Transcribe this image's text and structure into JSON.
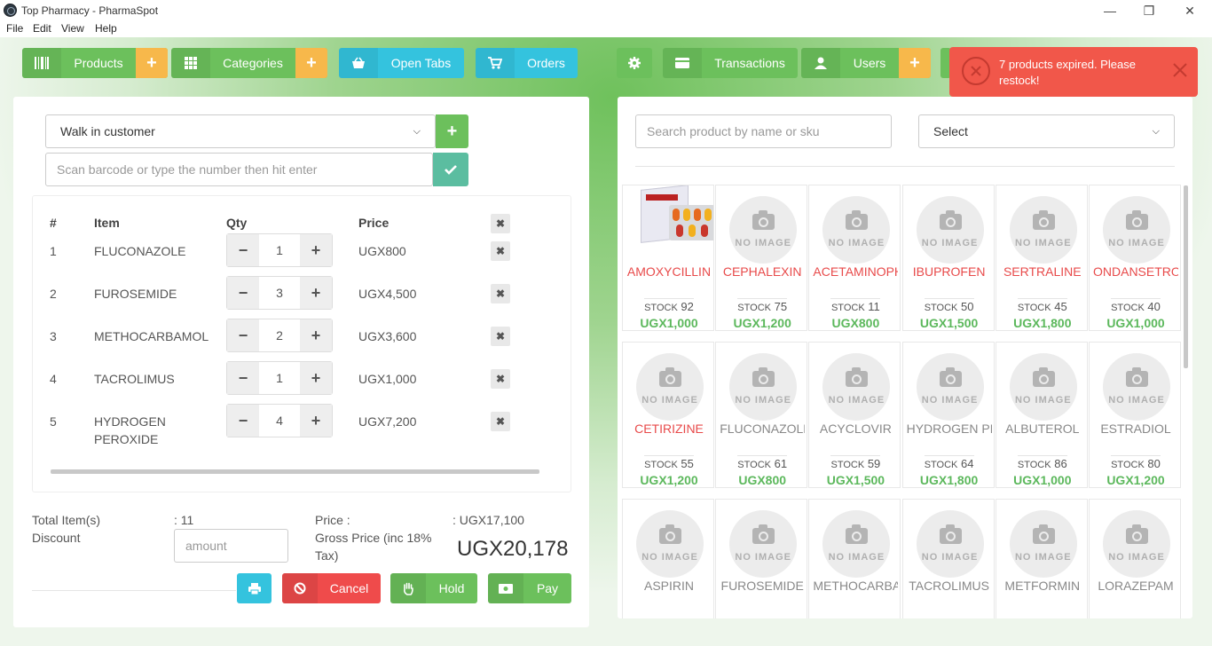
{
  "window": {
    "title": "Top Pharmacy - PharmaSpot",
    "minimize": "—",
    "restore": "❐",
    "close": "✕"
  },
  "menu": [
    "File",
    "Edit",
    "View",
    "Help"
  ],
  "toolbar": {
    "products": "Products",
    "categories": "Categories",
    "open_tabs": "Open Tabs",
    "orders": "Orders",
    "transactions": "Transactions",
    "users": "Users",
    "plus": "+"
  },
  "toast": {
    "message": "7 products expired. Please restock!"
  },
  "customer_select": {
    "value": "Walk in customer"
  },
  "barcode": {
    "placeholder": "Scan barcode or type the number then hit enter"
  },
  "cart": {
    "headers": {
      "num": "#",
      "item": "Item",
      "qty": "Qty",
      "price": "Price"
    },
    "rows": [
      {
        "num": "1",
        "item": "FLUCONAZOLE",
        "qty": "1",
        "price": "UGX800"
      },
      {
        "num": "2",
        "item": "FUROSEMIDE",
        "qty": "3",
        "price": "UGX4,500"
      },
      {
        "num": "3",
        "item": "METHOCARBAMOL",
        "qty": "2",
        "price": "UGX3,600"
      },
      {
        "num": "4",
        "item": "TACROLIMUS",
        "qty": "1",
        "price": "UGX1,000"
      },
      {
        "num": "5",
        "item": "HYDROGEN PEROXIDE",
        "qty": "4",
        "price": "UGX7,200"
      }
    ]
  },
  "totals": {
    "total_items_label": "Total Item(s)",
    "total_items_value": ": 11",
    "discount_label": "Discount",
    "discount_placeholder": "amount",
    "price_label": "Price :",
    "price_value": ": UGX17,100",
    "gross_label": "Gross Price (inc 18% Tax)",
    "gross_value": "UGX20,178"
  },
  "actions": {
    "cancel": "Cancel",
    "hold": "Hold",
    "pay": "Pay"
  },
  "search": {
    "placeholder": "Search product by name or sku",
    "category_select": "Select"
  },
  "products": [
    {
      "name": "AMOXYCILLIN",
      "stock": "92",
      "price": "UGX1,000",
      "expired": true,
      "has_image": true
    },
    {
      "name": "CEPHALEXIN",
      "stock": "75",
      "price": "UGX1,200",
      "expired": true,
      "has_image": false
    },
    {
      "name": "ACETAMINOPHEN",
      "stock": "11",
      "price": "UGX800",
      "expired": true,
      "has_image": false
    },
    {
      "name": "IBUPROFEN",
      "stock": "50",
      "price": "UGX1,500",
      "expired": true,
      "has_image": false
    },
    {
      "name": "SERTRALINE",
      "stock": "45",
      "price": "UGX1,800",
      "expired": true,
      "has_image": false
    },
    {
      "name": "ONDANSETRON",
      "stock": "40",
      "price": "UGX1,000",
      "expired": true,
      "has_image": false
    },
    {
      "name": "CETIRIZINE",
      "stock": "55",
      "price": "UGX1,200",
      "expired": true,
      "has_image": false
    },
    {
      "name": "FLUCONAZOLE",
      "stock": "61",
      "price": "UGX800",
      "expired": false,
      "has_image": false
    },
    {
      "name": "ACYCLOVIR",
      "stock": "59",
      "price": "UGX1,500",
      "expired": false,
      "has_image": false
    },
    {
      "name": "HYDROGEN PEROXIDE",
      "stock": "64",
      "price": "UGX1,800",
      "expired": false,
      "has_image": false
    },
    {
      "name": "ALBUTEROL",
      "stock": "86",
      "price": "UGX1,000",
      "expired": false,
      "has_image": false
    },
    {
      "name": "ESTRADIOL",
      "stock": "80",
      "price": "UGX1,200",
      "expired": false,
      "has_image": false
    },
    {
      "name": "ASPIRIN",
      "stock": "",
      "price": "",
      "expired": false,
      "has_image": false
    },
    {
      "name": "FUROSEMIDE",
      "stock": "",
      "price": "",
      "expired": false,
      "has_image": false
    },
    {
      "name": "METHOCARBAMOL",
      "stock": "",
      "price": "",
      "expired": false,
      "has_image": false
    },
    {
      "name": "TACROLIMUS",
      "stock": "",
      "price": "",
      "expired": false,
      "has_image": false
    },
    {
      "name": "METFORMIN",
      "stock": "",
      "price": "",
      "expired": false,
      "has_image": false
    },
    {
      "name": "LORAZEPAM",
      "stock": "",
      "price": "",
      "expired": false,
      "has_image": false
    }
  ],
  "labels": {
    "no_image": "NO IMAGE",
    "stock": "STOCK"
  },
  "colors": {
    "green": "#6cc05c",
    "cyan": "#34c3de",
    "orange": "#f7b84b",
    "red": "#f1574a",
    "expired_text": "#e84a4a",
    "normal_text": "#888888"
  }
}
